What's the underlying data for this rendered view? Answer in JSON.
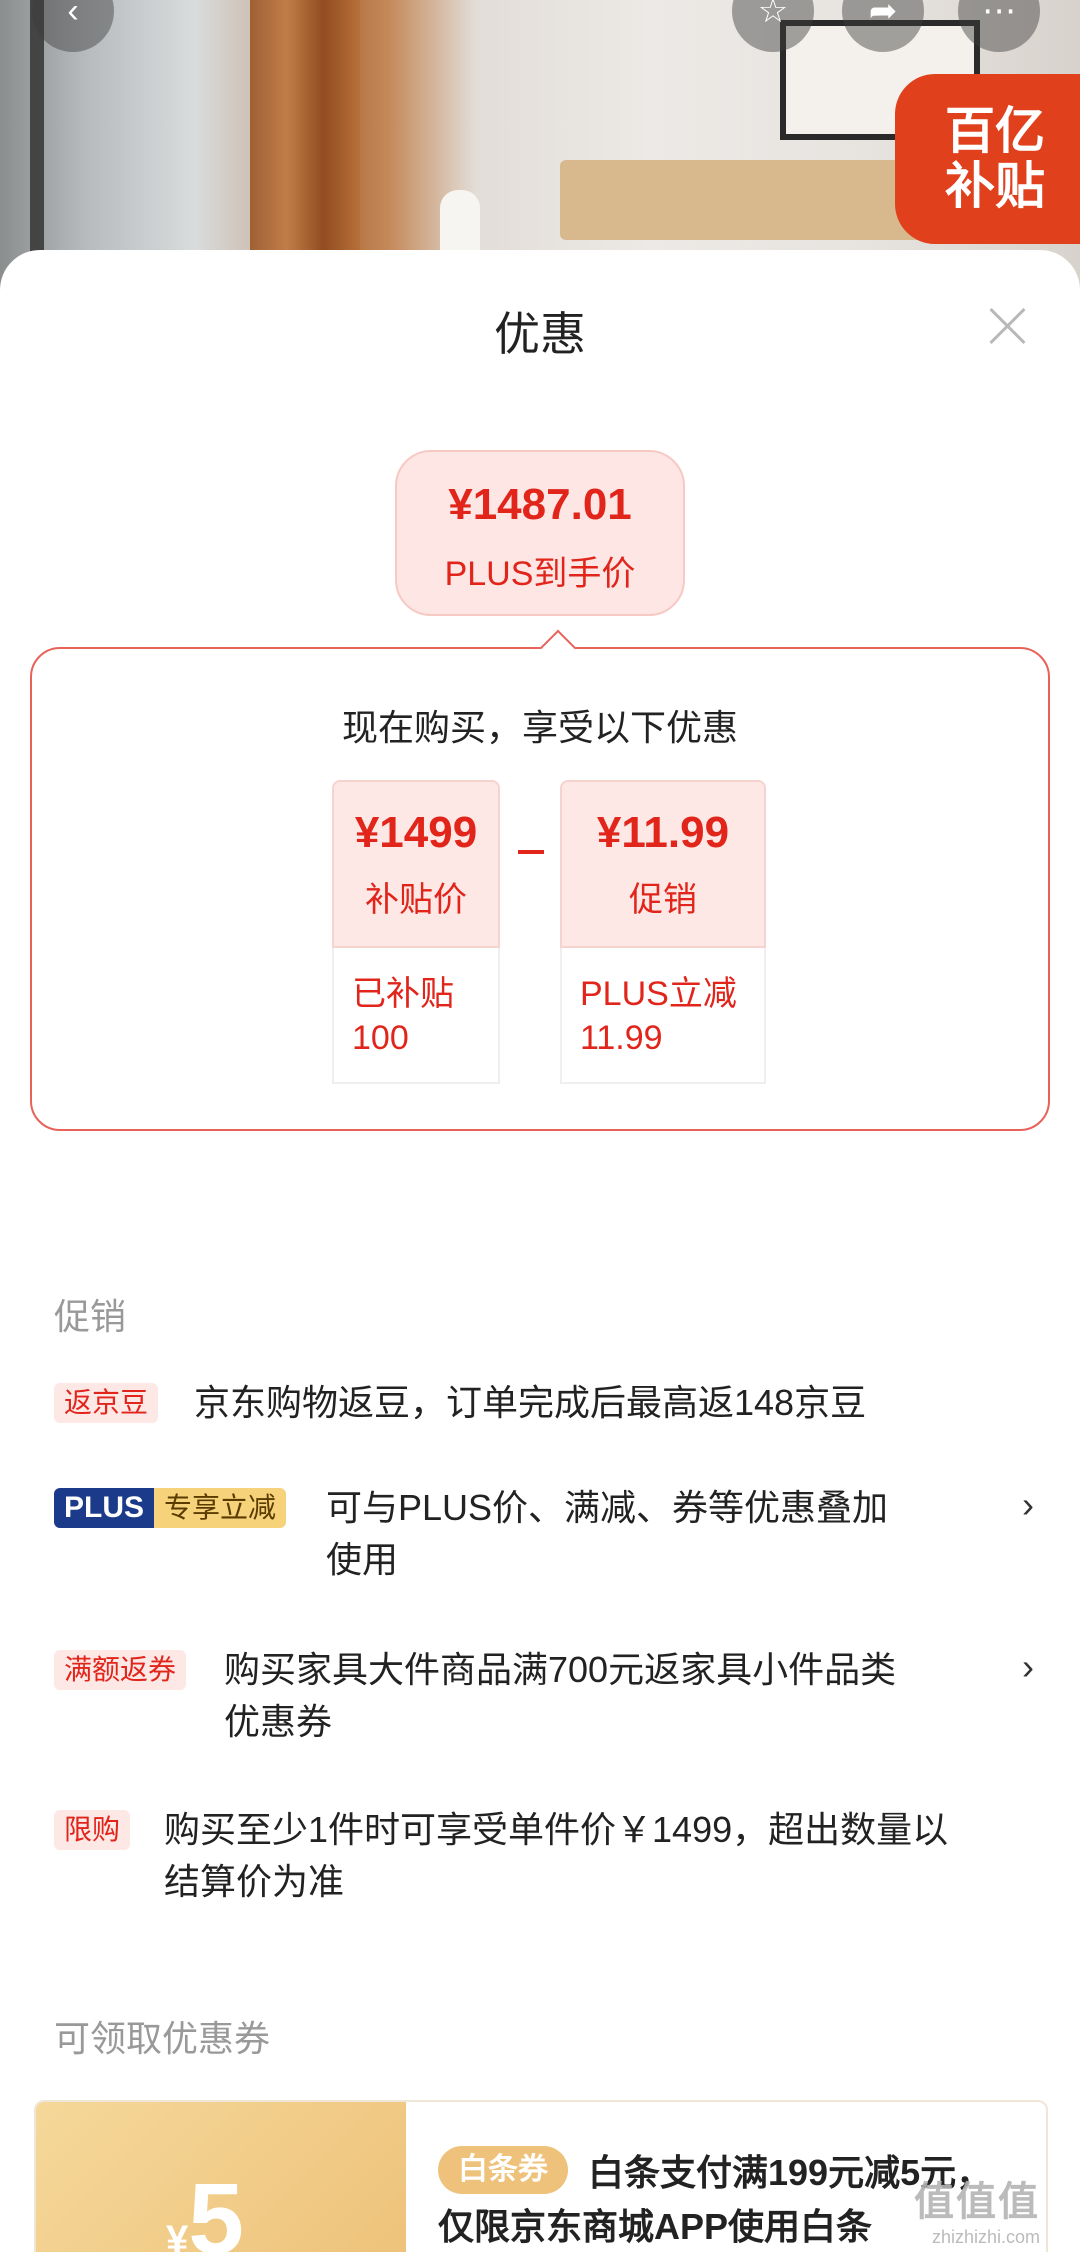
{
  "header": {
    "badge_line1": "百亿",
    "badge_line2": "补贴"
  },
  "sheet": {
    "title": "优惠",
    "final_price": {
      "amount": "¥1487.01",
      "label": "PLUS到手价"
    },
    "breakdown": {
      "title": "现在购买，享受以下优惠",
      "items": [
        {
          "amount": "¥1499",
          "label": "补贴价",
          "note_line1": "已补贴",
          "note_line2": "100"
        },
        {
          "amount": "¥11.99",
          "label": "促销",
          "note_line1": "PLUS立减",
          "note_line2": "11.99"
        }
      ]
    },
    "promotions_title": "促销",
    "promotions": [
      {
        "tag": "返京豆",
        "text": "京东购物返豆，订单完成后最高返148京豆"
      },
      {
        "tag_a": "PLUS",
        "tag_b": "专享立减",
        "text_l1": "可与PLUS价、满减、券等优惠叠加",
        "text_l2": "使用"
      },
      {
        "tag": "满额返券",
        "text_l1": "购买家具大件商品满700元返家具小件品类",
        "text_l2": "优惠券"
      },
      {
        "tag": "限购",
        "text_l1": "购买至少1件时可享受单件价￥1499，超出数量以",
        "text_l2": "结算价为准"
      }
    ],
    "coupons_title": "可领取优惠券",
    "coupon": {
      "currency": "¥",
      "value": "5",
      "tag": "白条券",
      "text": "白条支付满199元减5元，仅限京东商城APP使用白条"
    },
    "watermark": {
      "line1": "值值值",
      "line2": "zhizhizhi.com"
    }
  }
}
